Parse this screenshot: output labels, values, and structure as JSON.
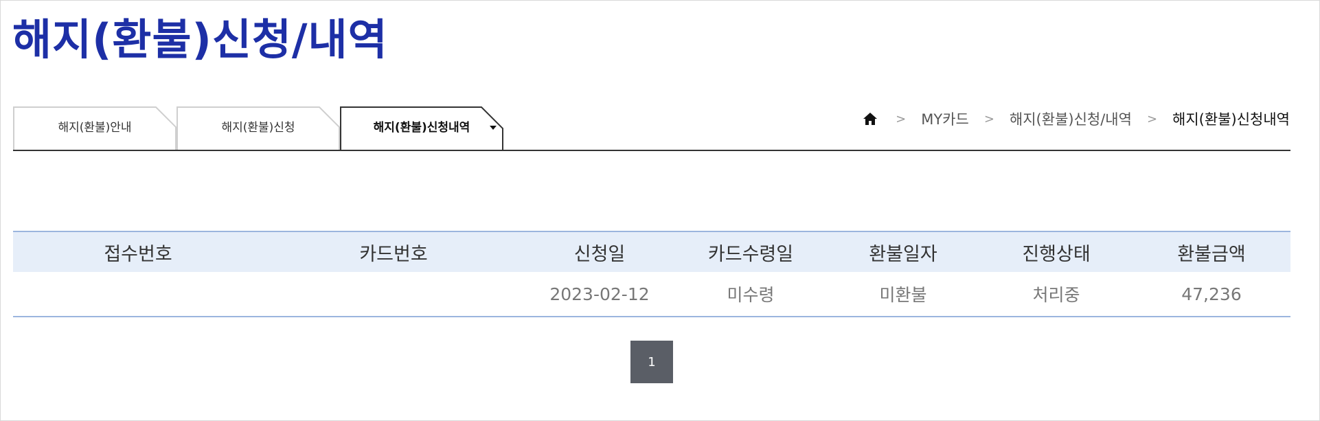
{
  "page": {
    "title": "해지(환불)신청/내역"
  },
  "tabs": [
    {
      "label": "해지(환불)안내"
    },
    {
      "label": "해지(환불)신청"
    },
    {
      "label": "해지(환불)신청내역",
      "active": true
    }
  ],
  "breadcrumb": {
    "home_icon": "home-icon",
    "separator": ">",
    "items": [
      "MY카드",
      "해지(환불)신청/내역",
      "해지(환불)신청내역"
    ]
  },
  "table": {
    "headers": [
      "접수번호",
      "카드번호",
      "신청일",
      "카드수령일",
      "환불일자",
      "진행상태",
      "환불금액"
    ],
    "rows": [
      [
        "",
        "",
        "2023-02-12",
        "미수령",
        "미환불",
        "처리중",
        "47,236"
      ]
    ]
  },
  "pagination": {
    "current": "1"
  },
  "colors": {
    "title": "#1d2fa6",
    "header_bg": "#e6eef9",
    "table_border": "#9bb5de",
    "pager_bg": "#5a5e66"
  }
}
